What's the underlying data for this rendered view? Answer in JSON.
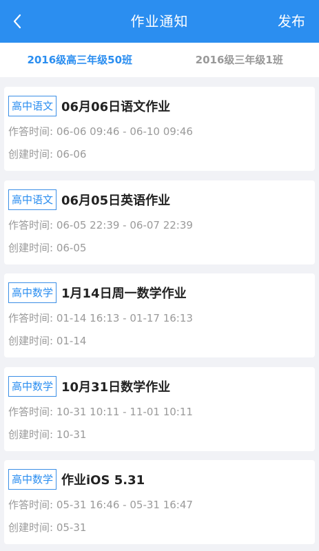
{
  "header": {
    "title": "作业通知",
    "action_label": "发布",
    "back_icon": "chevron-left-icon"
  },
  "colors": {
    "accent": "#2b8ef0",
    "background": "#f1f2f6"
  },
  "tabs": [
    {
      "label": "2016级高三年级50班",
      "active": true
    },
    {
      "label": "2016级三年级1班",
      "active": false
    }
  ],
  "homework": [
    {
      "subject": "高中语文",
      "title": "06月06日语文作业",
      "answer_time": "作答时间: 06-06 09:46 - 06-10 09:46",
      "created": "创建时间: 06-06"
    },
    {
      "subject": "高中语文",
      "title": "06月05日英语作业",
      "answer_time": "作答时间: 06-05 22:39 - 06-07 22:39",
      "created": "创建时间: 06-05"
    },
    {
      "subject": "高中数学",
      "title": "1月14日周一数学作业",
      "answer_time": "作答时间: 01-14 16:13 - 01-17 16:13",
      "created": "创建时间: 01-14"
    },
    {
      "subject": "高中数学",
      "title": "10月31日数学作业",
      "answer_time": "作答时间: 10-31 10:11 - 11-01 10:11",
      "created": "创建时间: 10-31"
    },
    {
      "subject": "高中数学",
      "title": "作业iOS 5.31",
      "answer_time": "作答时间: 05-31 16:46 - 05-31 16:47",
      "created": "创建时间: 05-31"
    }
  ]
}
